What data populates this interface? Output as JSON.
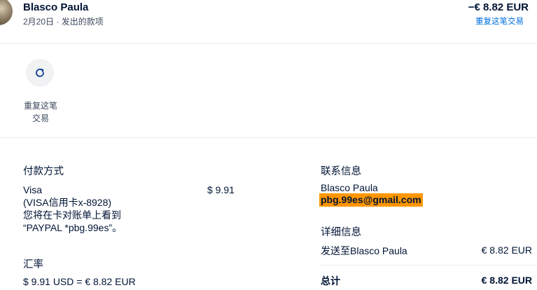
{
  "header": {
    "name": "Blasco Paula",
    "date": "2月20日",
    "separator": "·",
    "type": "发出的款项",
    "amount": "−€ 8.82 EUR",
    "repeat_link": "重复这笔交易"
  },
  "actions": {
    "repeat_label_line1": "重复这笔",
    "repeat_label_line2": "交易"
  },
  "payment": {
    "heading": "付款方式",
    "method": "Visa",
    "card": "(VISA信用卡x-8928)",
    "statement_line1": "您将在卡对账单上看到",
    "statement_line2": "“PAYPAL *pbg.99es”。",
    "amount": "$ 9.91"
  },
  "exchange": {
    "heading": "汇率",
    "rate": "$ 9.91 USD = € 8.82 EUR"
  },
  "contact": {
    "heading": "联系信息",
    "name": "Blasco Paula",
    "email": "pbg.99es@gmail.com"
  },
  "details": {
    "heading": "详细信息",
    "sent_to_label": "发送至Blasco Paula",
    "sent_to_amount": "€ 8.82 EUR",
    "total_label": "总计",
    "total_amount": "€ 8.82 EUR"
  },
  "colors": {
    "link": "#0070e0",
    "highlight": "#ff9600",
    "text": "#001435"
  },
  "icons": {
    "repeat": "refresh-icon"
  }
}
